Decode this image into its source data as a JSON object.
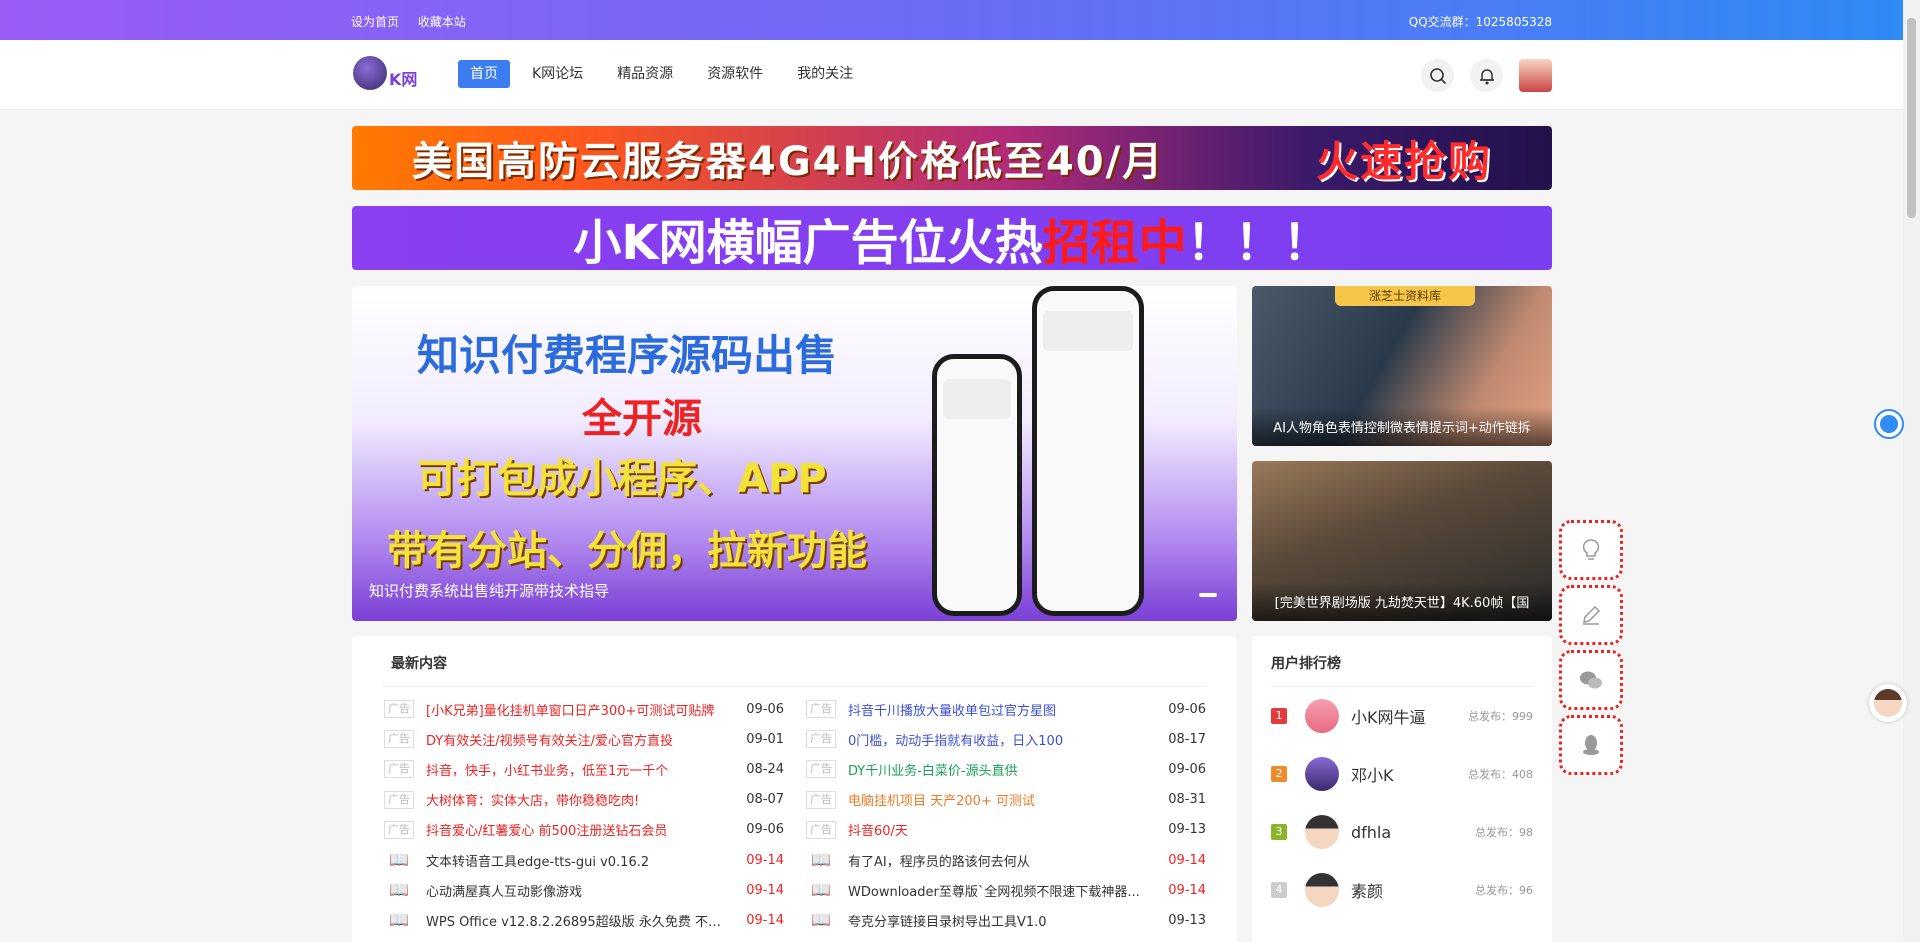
{
  "topbar": {
    "set_home": "设为首页",
    "bookmark": "收藏本站",
    "qq_group": "QQ交流群：1025805328"
  },
  "logo": {
    "text": "K网"
  },
  "nav": [
    "首页",
    "K网论坛",
    "精品资源",
    "资源软件",
    "我的关注"
  ],
  "banners": {
    "b1_left": "美国高防云服务器4G4H价格低至40/月",
    "b1_right": "火速抢购",
    "b2_prefix": "小K网横幅广告位火热",
    "b2_highlight": "招租中",
    "b2_suffix": "！！！"
  },
  "slider": {
    "line1": "知识付费程序源码出售",
    "line2": "全开源",
    "line3": "可打包成小程序、APP",
    "line4": "带有分站、分佣，拉新功能",
    "caption": "知识付费系统出售纯开源带技术指导"
  },
  "side_cards": [
    {
      "tag": "涨芝士资料库",
      "caption": "AI人物角色表情控制微表情提示词+动作链拆"
    },
    {
      "caption": "[完美世界剧场版 九劫焚天世】4K.60帧【国"
    }
  ],
  "latest": {
    "title": "最新内容",
    "badge": "广告",
    "left": [
      {
        "title": "[小K兄弟]量化挂机单窗口日产300+可测试可贴牌",
        "date": "09-06",
        "color": "#e22",
        "ad": true
      },
      {
        "title": "DY有效关注/视频号有效关注/爱心官方直投",
        "date": "09-01",
        "color": "#e22",
        "ad": true
      },
      {
        "title": "抖音，快手，小红书业务，低至1元一千个",
        "date": "08-24",
        "color": "#e22",
        "ad": true
      },
      {
        "title": "大树体育：实体大店，带你稳稳吃肉!",
        "date": "08-07",
        "color": "#e22",
        "ad": true
      },
      {
        "title": "抖音爱心/红薯爱心 前500注册送钻石会员",
        "date": "09-06",
        "color": "#e22",
        "ad": true
      },
      {
        "title": "文本转语音工具edge-tts-gui v0.16.2",
        "date": "09-14",
        "color": "#333",
        "ad": false,
        "red_date": true
      },
      {
        "title": "心动满屋真人互动影像游戏",
        "date": "09-14",
        "color": "#333",
        "ad": false,
        "red_date": true
      },
      {
        "title": "WPS Office v12.8.2.26895超级版 永久免费 不用...",
        "date": "09-14",
        "color": "#333",
        "ad": false,
        "red_date": true
      }
    ],
    "right": [
      {
        "title": "抖音千川播放大量收单包过官方星图",
        "date": "09-06",
        "color": "#3b50d6",
        "ad": true
      },
      {
        "title": "0门槛，动动手指就有收益，日入100",
        "date": "08-17",
        "color": "#3b50d6",
        "ad": true
      },
      {
        "title": "DY千川业务-白菜价-源头直供",
        "date": "09-06",
        "color": "#1aa05a",
        "ad": true
      },
      {
        "title": "电脑挂机项目 天产200+ 可测试",
        "date": "08-31",
        "color": "#f07a2a",
        "ad": true
      },
      {
        "title": "抖音60/天",
        "date": "09-13",
        "color": "#e22",
        "ad": true
      },
      {
        "title": "有了AI，程序员的路该何去何从",
        "date": "09-14",
        "color": "#333",
        "ad": false,
        "red_date": true
      },
      {
        "title": "WDownloader至尊版`全网视频不限速下载神器...",
        "date": "09-14",
        "color": "#333",
        "ad": false,
        "red_date": true
      },
      {
        "title": "夸克分享链接目录树导出工具V1.0",
        "date": "09-13",
        "color": "#333",
        "ad": false,
        "red_date": false
      }
    ]
  },
  "ranking": {
    "title": "用户排行榜",
    "count_prefix": "总发布：",
    "items": [
      {
        "rank": "1",
        "name": "小K网牛逼",
        "count": "999",
        "color": "#e23b3b"
      },
      {
        "rank": "2",
        "name": "邓小K",
        "count": "408",
        "color": "#f08a2a"
      },
      {
        "rank": "3",
        "name": "dfhla",
        "count": "98",
        "color": "#8ab52a"
      },
      {
        "rank": "4",
        "name": "素颜",
        "count": "96",
        "color": "#cccccc"
      }
    ]
  },
  "icons": {
    "search": "search-icon",
    "bell": "bell-icon",
    "bulb": "lightbulb-icon",
    "edit": "edit-icon",
    "wechat": "wechat-icon",
    "qq": "qq-icon"
  }
}
